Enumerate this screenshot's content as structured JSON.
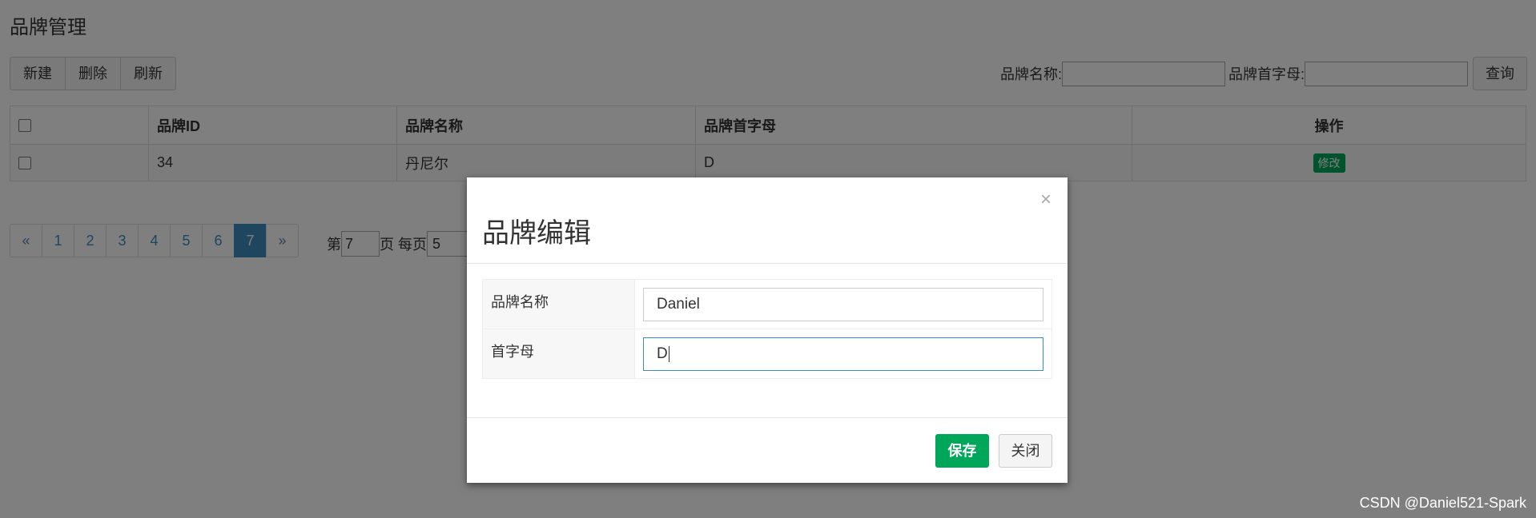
{
  "page": {
    "title": "品牌管理"
  },
  "toolbar": {
    "new_label": "新建",
    "delete_label": "删除",
    "refresh_label": "刷新"
  },
  "search": {
    "name_label": "品牌名称:",
    "name_value": "",
    "letter_label": "品牌首字母:",
    "letter_value": "",
    "query_label": "查询"
  },
  "table": {
    "headers": {
      "id": "品牌ID",
      "name": "品牌名称",
      "letter": "品牌首字母",
      "ops": "操作"
    },
    "rows": [
      {
        "id": "34",
        "name": "丹尼尔",
        "letter": "D",
        "edit_label": "修改"
      }
    ]
  },
  "pagination": {
    "prev": "«",
    "pages": [
      "1",
      "2",
      "3",
      "4",
      "5",
      "6",
      "7"
    ],
    "current": "7",
    "next": "»",
    "page_prefix": "第",
    "page_value": "7",
    "page_suffix": "页 每页",
    "per_page_value": "5"
  },
  "modal": {
    "title": "品牌编辑",
    "close_symbol": "×",
    "fields": {
      "name_label": "品牌名称",
      "name_value": "Daniel",
      "letter_label": "首字母",
      "letter_value": "D"
    },
    "save_label": "保存",
    "close_label": "关闭"
  },
  "watermark": "CSDN @Daniel521-Spark",
  "colors": {
    "primary": "#3c8dbc",
    "success": "#00a65a",
    "backdrop": "rgba(0,0,0,0.5)"
  }
}
